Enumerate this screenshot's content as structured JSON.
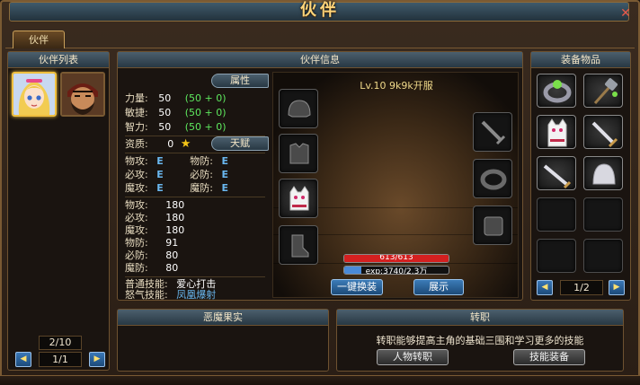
{
  "window": {
    "title": "伙伴",
    "close": "✕"
  },
  "tabs": [
    {
      "label": "伙伴"
    }
  ],
  "partner_list": {
    "header": "伙伴列表",
    "count": "2/10",
    "page": "1/1",
    "prev": "◀",
    "next": "▶"
  },
  "info": {
    "header": "伙伴信息",
    "attr_tab": "属性",
    "talent_tab": "天赋",
    "base_stats": [
      {
        "label": "力量:",
        "value": "50",
        "bonus": "(50 + 0)"
      },
      {
        "label": "敏捷:",
        "value": "50",
        "bonus": "(50 + 0)"
      },
      {
        "label": "智力:",
        "value": "50",
        "bonus": "(50 + 0)"
      }
    ],
    "aptitude": {
      "label": "资质:",
      "value": "0",
      "star": "★"
    },
    "grades": [
      {
        "label1": "物攻:",
        "grade1": "E",
        "label2": "物防:",
        "grade2": "E"
      },
      {
        "label1": "必攻:",
        "grade1": "E",
        "label2": "必防:",
        "grade2": "E"
      },
      {
        "label1": "魔攻:",
        "grade1": "E",
        "label2": "魔防:",
        "grade2": "E"
      }
    ],
    "values": [
      {
        "label": "物攻:",
        "value": "180"
      },
      {
        "label": "必攻:",
        "value": "180"
      },
      {
        "label": "魔攻:",
        "value": "180"
      },
      {
        "label": "物防:",
        "value": "91"
      },
      {
        "label": "必防:",
        "value": "80"
      },
      {
        "label": "魔防:",
        "value": "80"
      }
    ],
    "skills": [
      {
        "label": "普通技能:",
        "name": "爱心打击"
      },
      {
        "label": "怒气技能:",
        "name": "凤凰爆射"
      }
    ],
    "level_line": "Lv.10  9k9k开服",
    "hp": {
      "text": "613/613",
      "fraction": 1.0,
      "color": "#d42020"
    },
    "exp": {
      "text": "exp:3740/2.3万",
      "fraction": 0.16,
      "color": "#4a8ad8"
    },
    "one_key_button": "一键换装",
    "show_button": "展示"
  },
  "equipment": {
    "header": "装备物品",
    "page": "1/2",
    "prev": "◀",
    "next": "▶"
  },
  "devil_fruit": {
    "header": "恶魔果实"
  },
  "job": {
    "header": "转职",
    "description": "转职能够提高主角的基础三围和学习更多的技能",
    "job_button": "人物转职",
    "skill_button": "技能装备"
  }
}
